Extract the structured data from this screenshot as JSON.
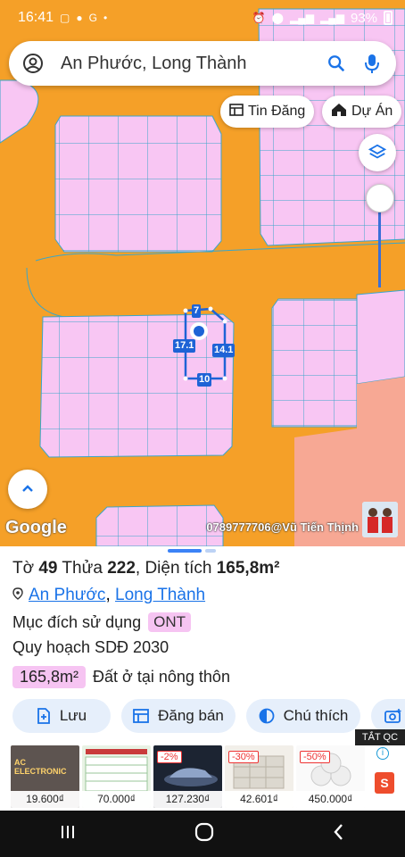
{
  "status": {
    "time": "16:41",
    "battery": "93%"
  },
  "search": {
    "query": "An Phước, Long Thành"
  },
  "chips": {
    "listing": "Tin Đăng",
    "project": "Dự Án"
  },
  "map": {
    "dimensions": {
      "top": "7",
      "left": "17.1",
      "right": "14.1",
      "bottom": "10"
    },
    "google_label": "Google",
    "owner_credit": "0789777706@Vũ Tiến Thịnh"
  },
  "parcel": {
    "title_prefix": "Tờ ",
    "sheet_number": "49",
    "plot_prefix": " Thửa ",
    "plot_number": "222",
    "area_prefix": ", Diện tích ",
    "area": "165,8m²",
    "ward": "An Phước",
    "separator": ", ",
    "district": "Long Thành",
    "purpose_label": "Mục đích sử dụng",
    "purpose_code": "ONT",
    "plan_label": "Quy hoạch SDĐ 2030",
    "plan_area": "165,8m²",
    "plan_use": "Đất ở tại nông thôn"
  },
  "actions": {
    "save": "Lưu",
    "post_sale": "Đăng bán",
    "legend": "Chú thích"
  },
  "ads": {
    "close_label": "TẮT QC",
    "items": [
      {
        "price": "19.600₫",
        "discount": "",
        "caption": "AC ELECTRONIC"
      },
      {
        "price": "70.000₫",
        "discount": ""
      },
      {
        "price": "127.230₫",
        "discount": "-2%"
      },
      {
        "price": "42.601₫",
        "discount": "-30%"
      },
      {
        "price": "450.000₫",
        "discount": "-50%"
      }
    ]
  },
  "colors": {
    "road": "#f5a028",
    "lot": "#f8c6f3",
    "lot_grid": "#3aa6c9",
    "commercial": "#f7a894",
    "accent": "#1a73e8"
  }
}
